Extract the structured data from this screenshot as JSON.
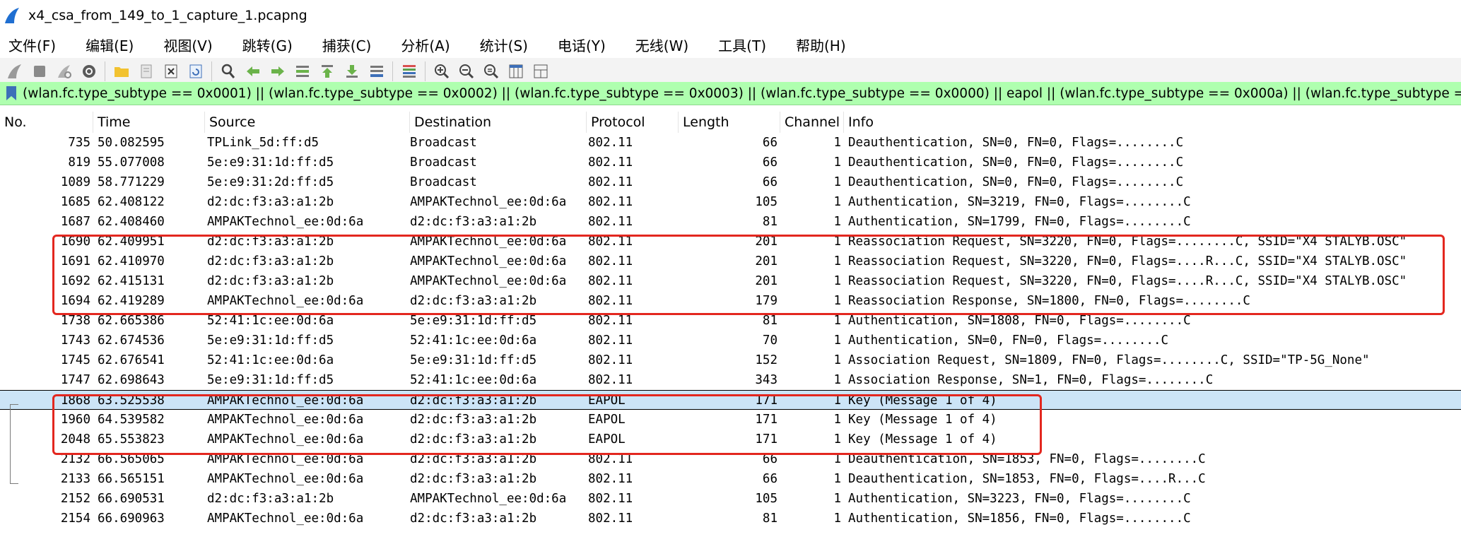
{
  "window": {
    "title": "x4_csa_from_149_to_1_capture_1.pcapng"
  },
  "menu": [
    "文件(F)",
    "编辑(E)",
    "视图(V)",
    "跳转(G)",
    "捕获(C)",
    "分析(A)",
    "统计(S)",
    "电话(Y)",
    "无线(W)",
    "工具(T)",
    "帮助(H)"
  ],
  "toolbar": {
    "icons": [
      "shark-fin-start-icon",
      "stop-icon",
      "restart-icon",
      "options-gear-icon",
      "open-folder-icon",
      "file-set-icon",
      "close-file-icon",
      "reload-icon",
      "find-icon",
      "go-back-icon",
      "go-forward-icon",
      "go-to-packet-icon",
      "go-first-icon",
      "go-last-icon",
      "autoscroll-icon",
      "colorize-icon",
      "zoom-in-icon",
      "zoom-out-icon",
      "zoom-normal-icon",
      "resize-columns-icon",
      "layout-icon"
    ]
  },
  "filter": {
    "text": "(wlan.fc.type_subtype == 0x0001) || (wlan.fc.type_subtype == 0x0002) || (wlan.fc.type_subtype == 0x0003) || (wlan.fc.type_subtype == 0x0000) || eapol ||  (wlan.fc.type_subtype == 0x000a) || (wlan.fc.type_subtype == 0x000c) || (wlan.fc.type_subtype"
  },
  "columns": {
    "no": "No.",
    "time": "Time",
    "source": "Source",
    "destination": "Destination",
    "protocol": "Protocol",
    "length": "Length",
    "channel": "Channel",
    "info": "Info"
  },
  "packets": [
    {
      "no": "735",
      "time": "50.082595",
      "src": "TPLink_5d:ff:d5",
      "dst": "Broadcast",
      "proto": "802.11",
      "len": "66",
      "chan": "1",
      "info": "Deauthentication, SN=0, FN=0, Flags=........C"
    },
    {
      "no": "819",
      "time": "55.077008",
      "src": "5e:e9:31:1d:ff:d5",
      "dst": "Broadcast",
      "proto": "802.11",
      "len": "66",
      "chan": "1",
      "info": "Deauthentication, SN=0, FN=0, Flags=........C"
    },
    {
      "no": "1089",
      "time": "58.771229",
      "src": "5e:e9:31:2d:ff:d5",
      "dst": "Broadcast",
      "proto": "802.11",
      "len": "66",
      "chan": "1",
      "info": "Deauthentication, SN=0, FN=0, Flags=........C"
    },
    {
      "no": "1685",
      "time": "62.408122",
      "src": "d2:dc:f3:a3:a1:2b",
      "dst": "AMPAKTechnol_ee:0d:6a",
      "proto": "802.11",
      "len": "105",
      "chan": "1",
      "info": "Authentication, SN=3219, FN=0, Flags=........C"
    },
    {
      "no": "1687",
      "time": "62.408460",
      "src": "AMPAKTechnol_ee:0d:6a",
      "dst": "d2:dc:f3:a3:a1:2b",
      "proto": "802.11",
      "len": "81",
      "chan": "1",
      "info": "Authentication, SN=1799, FN=0, Flags=........C"
    },
    {
      "no": "1690",
      "time": "62.409951",
      "src": "d2:dc:f3:a3:a1:2b",
      "dst": "AMPAKTechnol_ee:0d:6a",
      "proto": "802.11",
      "len": "201",
      "chan": "1",
      "info": "Reassociation Request, SN=3220, FN=0, Flags=........C, SSID=\"X4 STALYB.OSC\""
    },
    {
      "no": "1691",
      "time": "62.410970",
      "src": "d2:dc:f3:a3:a1:2b",
      "dst": "AMPAKTechnol_ee:0d:6a",
      "proto": "802.11",
      "len": "201",
      "chan": "1",
      "info": "Reassociation Request, SN=3220, FN=0, Flags=....R...C, SSID=\"X4 STALYB.OSC\""
    },
    {
      "no": "1692",
      "time": "62.415131",
      "src": "d2:dc:f3:a3:a1:2b",
      "dst": "AMPAKTechnol_ee:0d:6a",
      "proto": "802.11",
      "len": "201",
      "chan": "1",
      "info": "Reassociation Request, SN=3220, FN=0, Flags=....R...C, SSID=\"X4 STALYB.OSC\""
    },
    {
      "no": "1694",
      "time": "62.419289",
      "src": "AMPAKTechnol_ee:0d:6a",
      "dst": "d2:dc:f3:a3:a1:2b",
      "proto": "802.11",
      "len": "179",
      "chan": "1",
      "info": "Reassociation Response, SN=1800, FN=0, Flags=........C"
    },
    {
      "no": "1738",
      "time": "62.665386",
      "src": "52:41:1c:ee:0d:6a",
      "dst": "5e:e9:31:1d:ff:d5",
      "proto": "802.11",
      "len": "81",
      "chan": "1",
      "info": "Authentication, SN=1808, FN=0, Flags=........C"
    },
    {
      "no": "1743",
      "time": "62.674536",
      "src": "5e:e9:31:1d:ff:d5",
      "dst": "52:41:1c:ee:0d:6a",
      "proto": "802.11",
      "len": "70",
      "chan": "1",
      "info": "Authentication, SN=0, FN=0, Flags=........C"
    },
    {
      "no": "1745",
      "time": "62.676541",
      "src": "52:41:1c:ee:0d:6a",
      "dst": "5e:e9:31:1d:ff:d5",
      "proto": "802.11",
      "len": "152",
      "chan": "1",
      "info": "Association Request, SN=1809, FN=0, Flags=........C, SSID=\"TP-5G_None\""
    },
    {
      "no": "1747",
      "time": "62.698643",
      "src": "5e:e9:31:1d:ff:d5",
      "dst": "52:41:1c:ee:0d:6a",
      "proto": "802.11",
      "len": "343",
      "chan": "1",
      "info": "Association Response, SN=1, FN=0, Flags=........C"
    },
    {
      "no": "1868",
      "time": "63.525538",
      "src": "AMPAKTechnol_ee:0d:6a",
      "dst": "d2:dc:f3:a3:a1:2b",
      "proto": "EAPOL",
      "len": "171",
      "chan": "1",
      "info": "Key (Message 1 of 4)",
      "selected": true
    },
    {
      "no": "1960",
      "time": "64.539582",
      "src": "AMPAKTechnol_ee:0d:6a",
      "dst": "d2:dc:f3:a3:a1:2b",
      "proto": "EAPOL",
      "len": "171",
      "chan": "1",
      "info": "Key (Message 1 of 4)"
    },
    {
      "no": "2048",
      "time": "65.553823",
      "src": "AMPAKTechnol_ee:0d:6a",
      "dst": "d2:dc:f3:a3:a1:2b",
      "proto": "EAPOL",
      "len": "171",
      "chan": "1",
      "info": "Key (Message 1 of 4)"
    },
    {
      "no": "2132",
      "time": "66.565065",
      "src": "AMPAKTechnol_ee:0d:6a",
      "dst": "d2:dc:f3:a3:a1:2b",
      "proto": "802.11",
      "len": "66",
      "chan": "1",
      "info": "Deauthentication, SN=1853, FN=0, Flags=........C"
    },
    {
      "no": "2133",
      "time": "66.565151",
      "src": "AMPAKTechnol_ee:0d:6a",
      "dst": "d2:dc:f3:a3:a1:2b",
      "proto": "802.11",
      "len": "66",
      "chan": "1",
      "info": "Deauthentication, SN=1853, FN=0, Flags=....R...C"
    },
    {
      "no": "2152",
      "time": "66.690531",
      "src": "d2:dc:f3:a3:a1:2b",
      "dst": "AMPAKTechnol_ee:0d:6a",
      "proto": "802.11",
      "len": "105",
      "chan": "1",
      "info": "Authentication, SN=3223, FN=0, Flags=........C"
    },
    {
      "no": "2154",
      "time": "66.690963",
      "src": "AMPAKTechnol_ee:0d:6a",
      "dst": "d2:dc:f3:a3:a1:2b",
      "proto": "802.11",
      "len": "81",
      "chan": "1",
      "info": "Authentication, SN=1856, FN=0, Flags=........C"
    }
  ],
  "colors": {
    "filter_bg": "#afffaf",
    "selected_row": "#cce4f7",
    "highlight_box": "#e3271f"
  }
}
